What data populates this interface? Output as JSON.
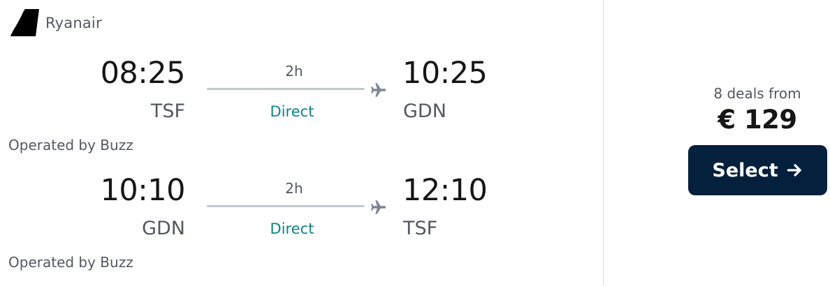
{
  "airline": {
    "name": "Ryanair",
    "icon": "ryanair-tail-logo"
  },
  "legs": [
    {
      "departure_time": "08:25",
      "departure_code": "TSF",
      "duration": "2h",
      "stops": "Direct",
      "arrival_time": "10:25",
      "arrival_code": "GDN",
      "operated_by": "Operated by Buzz"
    },
    {
      "departure_time": "10:10",
      "departure_code": "GDN",
      "duration": "2h",
      "stops": "Direct",
      "arrival_time": "12:10",
      "arrival_code": "TSF",
      "operated_by": "Operated by Buzz"
    }
  ],
  "pricing": {
    "deals": "8 deals from",
    "price": "€ 129",
    "select_label": "Select"
  },
  "colors": {
    "button_bg": "#05203c",
    "direct_text": "#0c838a",
    "route_line": "#c2c9cd"
  }
}
